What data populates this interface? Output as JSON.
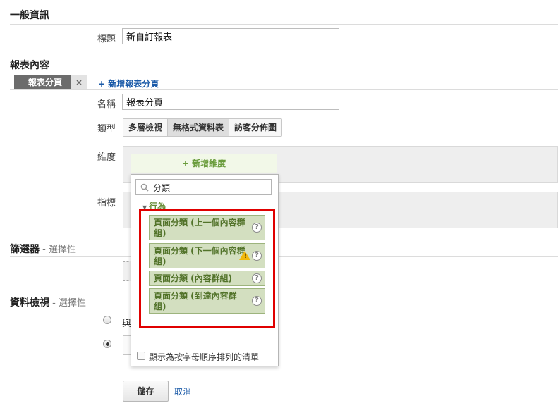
{
  "general": {
    "title": "一般資訊",
    "title_label": "標題",
    "title_value": "新自訂報表"
  },
  "content": {
    "title": "報表內容",
    "tab_label": "報表分頁",
    "tab_close": "×",
    "add_tab_link": "+ 新增報表分頁",
    "name_label": "名稱",
    "name_value": "報表分頁",
    "type_label": "類型",
    "types": [
      "多層檢視",
      "無格式資料表",
      "訪客分佈圖"
    ],
    "dimension_label": "維度",
    "add_dimension": "+ 新增維度",
    "metric_label": "指標"
  },
  "dropdown": {
    "search_value": "分類",
    "category": "行為",
    "items": [
      "頁面分類 (上一個內容群組)",
      "頁面分類 (下一個內容群組)",
      "頁面分類 (內容群組)",
      "頁面分類 (到達內容群組)"
    ],
    "help_glyph": "?",
    "alpha_checkbox_label": "顯示為按字母順序排列的清單"
  },
  "filters": {
    "title": "篩選器",
    "optional": " - 選擇性"
  },
  "views": {
    "title": "資料檢視",
    "optional": " - 選擇性",
    "option1_partial": "與"
  },
  "footer": {
    "save": "儲存",
    "cancel": "取消"
  },
  "colors": {
    "accent_link": "#1a5aa8",
    "highlight_frame": "#e00000",
    "dimension_item_bg": "#d3dfc0"
  }
}
